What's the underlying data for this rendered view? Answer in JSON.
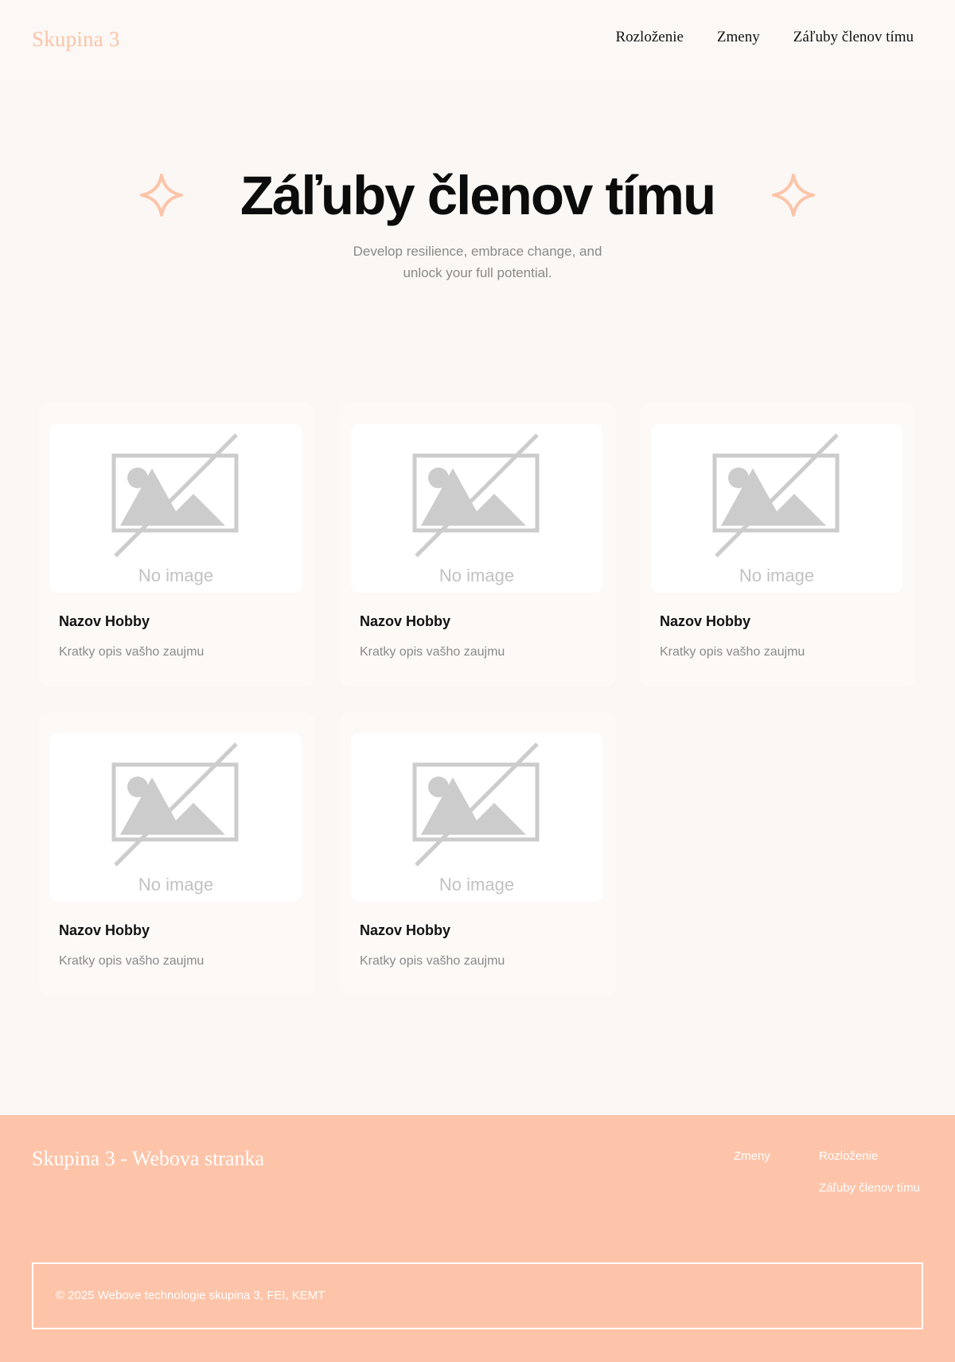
{
  "header": {
    "logo": "Skupina 3",
    "nav": [
      "Rozloženie",
      "Zmeny",
      "Záľuby členov tímu"
    ]
  },
  "hero": {
    "title": "Záľuby členov tímu",
    "subtitle_line1": "Develop resilience, embrace change, and",
    "subtitle_line2": "unlock your full potential."
  },
  "cards": [
    {
      "image_alt": "No image",
      "title": "Nazov Hobby",
      "description": "Kratky opis vašho zaujmu"
    },
    {
      "image_alt": "No image",
      "title": "Nazov Hobby",
      "description": "Kratky opis vašho zaujmu"
    },
    {
      "image_alt": "No image",
      "title": "Nazov Hobby",
      "description": "Kratky opis vašho zaujmu"
    },
    {
      "image_alt": "No image",
      "title": "Nazov Hobby",
      "description": "Kratky opis vašho zaujmu"
    },
    {
      "image_alt": "No image",
      "title": "Nazov Hobby",
      "description": "Kratky opis vašho zaujmu"
    }
  ],
  "footer": {
    "brand": "Skupina 3 - Webova stranka",
    "links": [
      "Zmeny",
      "Rozloženie",
      "Záľuby členov tímu"
    ],
    "copyright": "© 2025 Webove technologie skupina 3, FEI, KEMT"
  },
  "colors": {
    "accent": "#fcc4a8",
    "background": "#fbf7f4",
    "footer_bg": "#fec4a9",
    "text": "#111111",
    "muted_text": "#8a8a8a"
  },
  "icons": {
    "hero_left": "sparkle-star-icon",
    "hero_right": "sparkle-star-icon",
    "card_image": "image-placeholder-icon"
  }
}
